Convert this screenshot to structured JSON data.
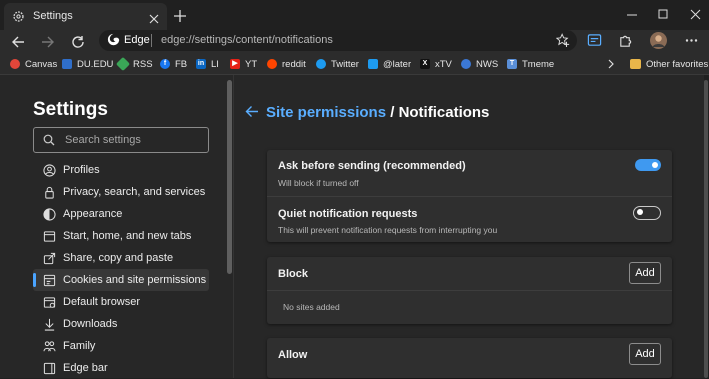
{
  "tab": {
    "title": "Settings",
    "icon": "gear-icon"
  },
  "address_bar": {
    "brand": "Edge",
    "url": "edge://settings/content/notifications"
  },
  "favorites": {
    "items": [
      {
        "label": "Canvas",
        "icon": "canvas-icon",
        "color": "#e2463a"
      },
      {
        "label": "DU.EDU",
        "icon": "du-icon",
        "color": "#2f6ec9"
      },
      {
        "label": "RSS",
        "icon": "rss-icon",
        "color": "#3aa657"
      },
      {
        "label": "FB",
        "icon": "facebook-icon",
        "color": "#1877f2"
      },
      {
        "label": "LI",
        "icon": "linkedin-icon",
        "color": "#0a66c2"
      },
      {
        "label": "YT",
        "icon": "youtube-icon",
        "color": "#e62117"
      },
      {
        "label": "reddit",
        "icon": "reddit-icon",
        "color": "#ff4500"
      },
      {
        "label": "Twitter",
        "icon": "twitter-icon",
        "color": "#1d9bf0"
      },
      {
        "label": "@later",
        "icon": "twitter-icon",
        "color": "#1d9bf0"
      },
      {
        "label": "xTV",
        "icon": "x-icon",
        "color": "#111111"
      },
      {
        "label": "NWS",
        "icon": "nws-icon",
        "color": "#3b78d6"
      },
      {
        "label": "Tmeme",
        "icon": "tmeme-icon",
        "color": "#5a8fd8"
      }
    ],
    "other": "Other favorites"
  },
  "sidebar": {
    "title": "Settings",
    "search_placeholder": "Search settings",
    "items": [
      {
        "label": "Profiles",
        "icon": "profile-icon",
        "active": false
      },
      {
        "label": "Privacy, search, and services",
        "icon": "lock-icon",
        "active": false
      },
      {
        "label": "Appearance",
        "icon": "appearance-icon",
        "active": false
      },
      {
        "label": "Start, home, and new tabs",
        "icon": "home-tabs-icon",
        "active": false
      },
      {
        "label": "Share, copy and paste",
        "icon": "share-icon",
        "active": false
      },
      {
        "label": "Cookies and site permissions",
        "icon": "cookies-icon",
        "active": true
      },
      {
        "label": "Default browser",
        "icon": "browser-icon",
        "active": false
      },
      {
        "label": "Downloads",
        "icon": "download-icon",
        "active": false
      },
      {
        "label": "Family",
        "icon": "family-icon",
        "active": false
      },
      {
        "label": "Edge bar",
        "icon": "edge-bar-icon",
        "active": false
      }
    ]
  },
  "main": {
    "breadcrumb_parent": "Site permissions",
    "breadcrumb_sep": " / ",
    "breadcrumb_current": "Notifications",
    "ask": {
      "title": "Ask before sending (recommended)",
      "subtitle": "Will block if turned off",
      "on": true
    },
    "quiet": {
      "title": "Quiet notification requests",
      "subtitle": "This will prevent notification requests from interrupting you",
      "on": false
    },
    "block": {
      "title": "Block",
      "add": "Add",
      "empty": "No sites added"
    },
    "allow": {
      "title": "Allow",
      "add": "Add"
    }
  },
  "colors": {
    "accent": "#3f99f0",
    "link": "#5aaeff"
  }
}
